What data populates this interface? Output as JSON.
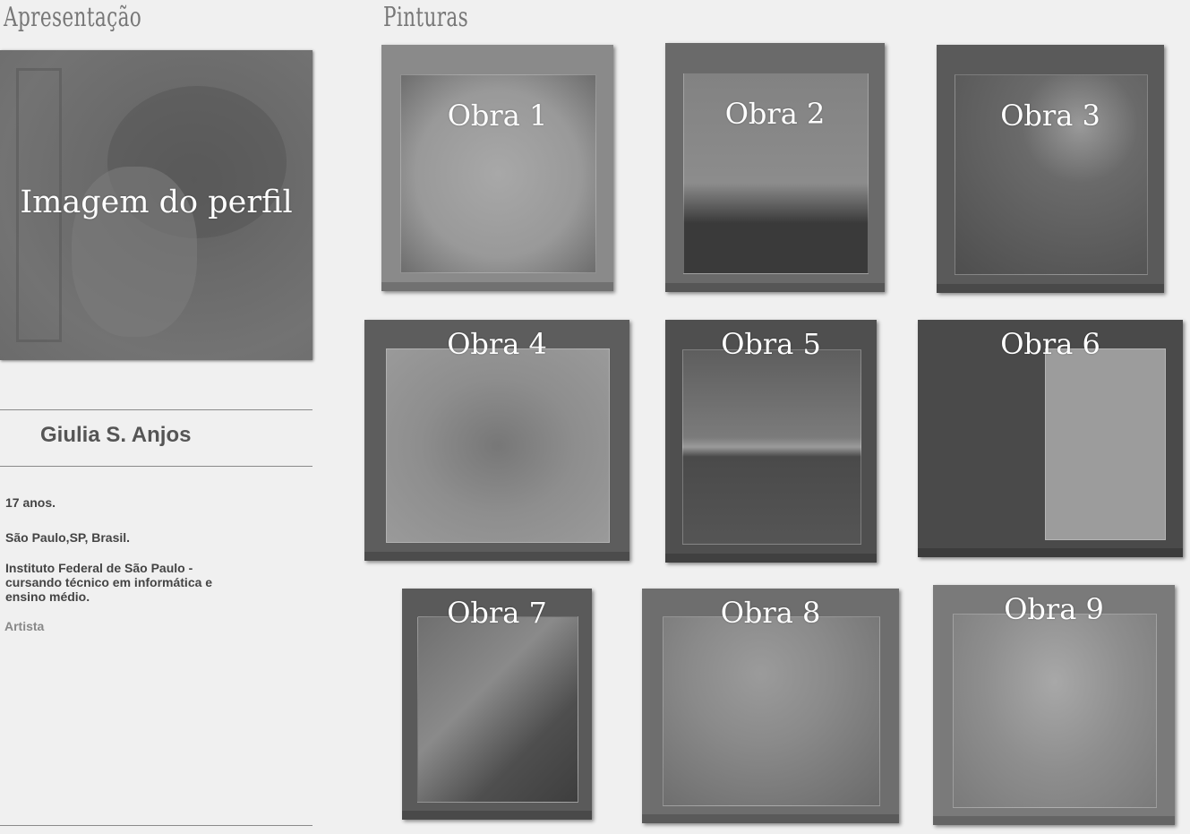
{
  "intro": {
    "title": "Apresentação",
    "profile_image_label": "Imagem do perfil",
    "name": "Giulia S. Anjos",
    "age": "17 anos.",
    "location": "São Paulo,SP, Brasil.",
    "school": "Instituto Federal de São Paulo - cursando técnico em informática e ensino médio.",
    "role": "Artista"
  },
  "paintings": {
    "title": "Pinturas",
    "items": [
      {
        "label": "Obra 1"
      },
      {
        "label": "Obra 2"
      },
      {
        "label": "Obra 3"
      },
      {
        "label": "Obra 4"
      },
      {
        "label": "Obra 5"
      },
      {
        "label": "Obra 6"
      },
      {
        "label": "Obra 7"
      },
      {
        "label": "Obra 8"
      },
      {
        "label": "Obra 9"
      }
    ]
  }
}
